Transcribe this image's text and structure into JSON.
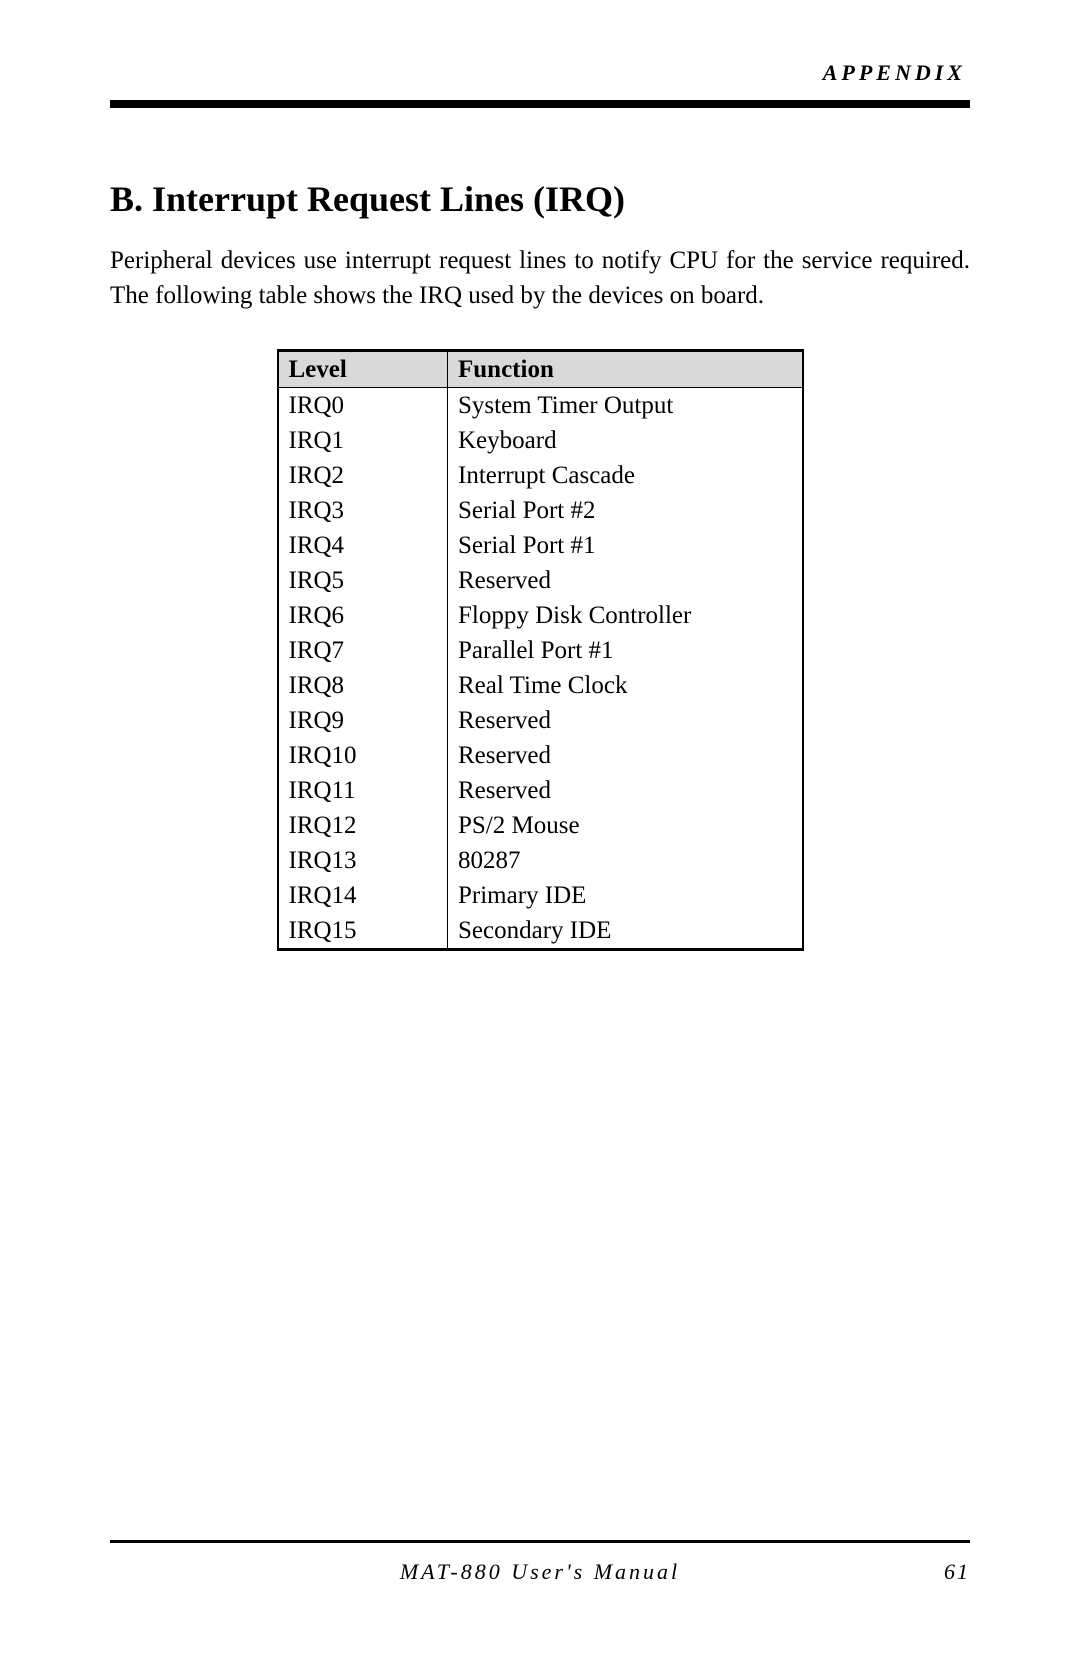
{
  "header": {
    "section_label": "APPENDIX"
  },
  "heading": "B. Interrupt Request Lines (IRQ)",
  "intro": "Peripheral devices use interrupt request lines to notify CPU for the service required. The following table shows the IRQ used by the devices on board.",
  "table": {
    "columns": [
      "Level",
      "Function"
    ],
    "rows": [
      {
        "level": "IRQ0",
        "function": "System Timer Output"
      },
      {
        "level": "IRQ1",
        "function": "Keyboard"
      },
      {
        "level": "IRQ2",
        "function": "Interrupt Cascade"
      },
      {
        "level": "IRQ3",
        "function": "Serial Port #2"
      },
      {
        "level": "IRQ4",
        "function": "Serial Port #1"
      },
      {
        "level": "IRQ5",
        "function": "Reserved"
      },
      {
        "level": "IRQ6",
        "function": "Floppy Disk Controller"
      },
      {
        "level": "IRQ7",
        "function": "Parallel Port #1"
      },
      {
        "level": "IRQ8",
        "function": "Real Time Clock"
      },
      {
        "level": "IRQ9",
        "function": "Reserved"
      },
      {
        "level": "IRQ10",
        "function": "Reserved"
      },
      {
        "level": "IRQ11",
        "function": "Reserved"
      },
      {
        "level": "IRQ12",
        "function": "PS/2 Mouse"
      },
      {
        "level": "IRQ13",
        "function": "80287"
      },
      {
        "level": "IRQ14",
        "function": "Primary IDE"
      },
      {
        "level": "IRQ15",
        "function": "Secondary IDE"
      }
    ]
  },
  "footer": {
    "manual_title": "MAT-880 User's Manual",
    "page_number": "61"
  }
}
